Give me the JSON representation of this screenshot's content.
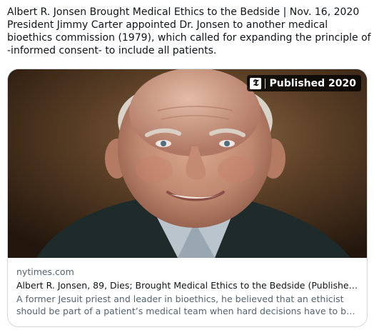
{
  "tweet": {
    "lines": [
      "Albert R. Jonsen Brought Medical Ethics to the Bedside | Nov. 16, 2020",
      "President Jimmy Carter appointed Dr. Jonsen to another medical",
      "bioethics commission (1979), which called for expanding the principle of",
      "-informed consent-  to include all patients."
    ]
  },
  "card": {
    "badge": {
      "logo_glyph": "𝕿",
      "label": "Published 2020",
      "icon": "nyt-logo-icon"
    },
    "image": {
      "subject": "portrait-photo",
      "colors": {
        "background": "#3a2818",
        "skin": "#c89276",
        "jacket": "#1f2a2b"
      }
    },
    "domain": "nytimes.com",
    "title": "Albert R. Jonsen, 89, Dies; Brought Medical Ethics to the Bedside (Published ...",
    "description": [
      "A former Jesuit priest and leader in bioethics, he believed that an ethicist",
      "should be part of a patient’s medical team when hard decisions have to be ..."
    ]
  },
  "colors": {
    "text_primary": "#0f1419",
    "text_secondary": "#536471",
    "card_border": "#cfd9de"
  }
}
